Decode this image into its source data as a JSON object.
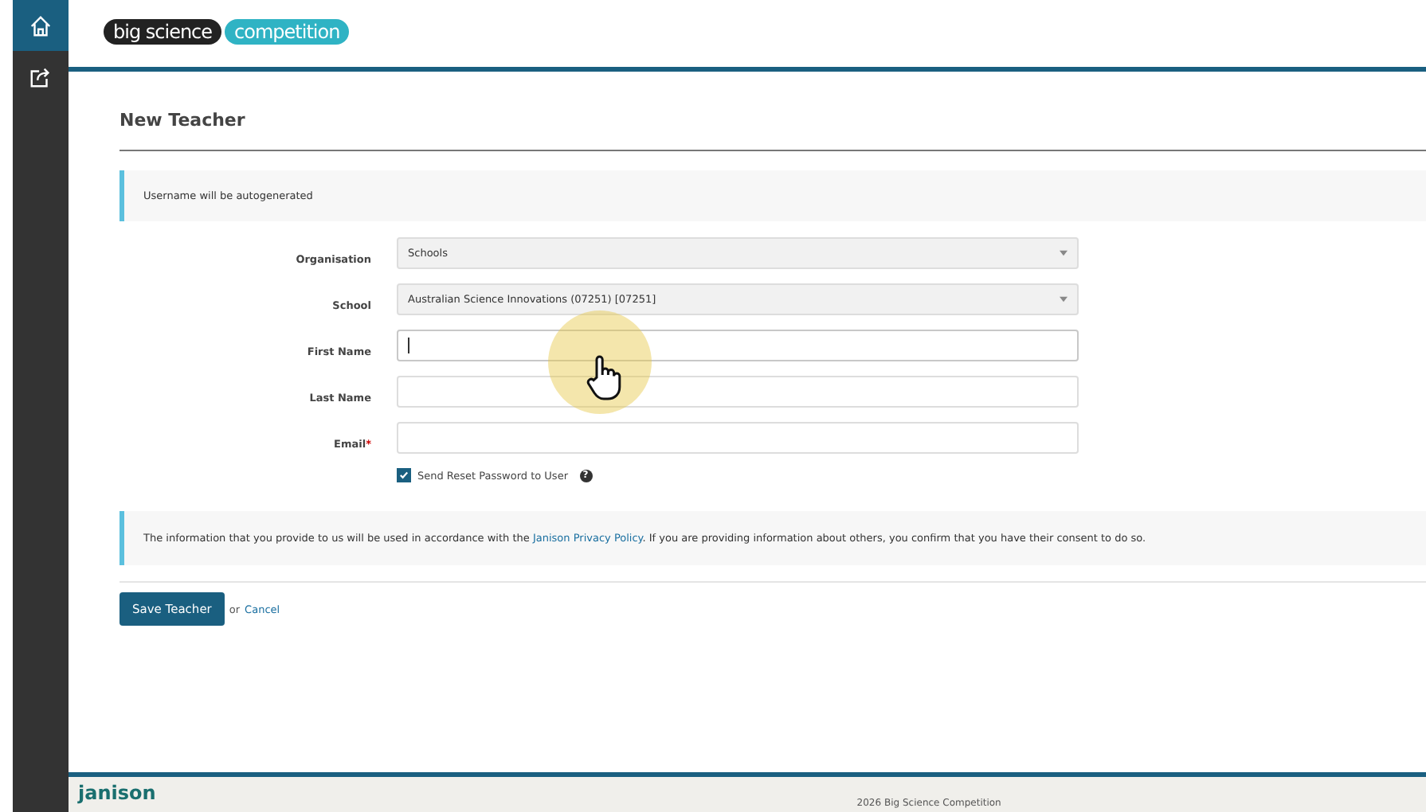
{
  "sidebar": {
    "items": [
      {
        "kind": "home",
        "selected": true
      },
      {
        "kind": "export",
        "selected": false
      }
    ]
  },
  "header": {
    "logo": {
      "part_1": "big science",
      "part_2": "competition"
    }
  },
  "page": {
    "title": "New Teacher",
    "notice": "Username will be autogenerated",
    "fields": [
      {
        "kind": "select",
        "label": "Organisation",
        "value": "Schools"
      },
      {
        "kind": "select",
        "label": "School",
        "value": "Australian Science Innovations (07251) [07251]"
      },
      {
        "kind": "text",
        "label": "First Name",
        "focused": true
      },
      {
        "kind": "text",
        "label": "Last Name",
        "focused": false
      },
      {
        "kind": "text",
        "label": "Email",
        "required_mark": "*",
        "focused": false
      }
    ],
    "checkbox": {
      "label": "Send Reset Password to User",
      "checked": true,
      "help": "?"
    },
    "privacy": {
      "before": "The information that you provide to us will be used in accordance with the",
      "link": "Janison Privacy Policy",
      "after": ". If you are providing information about others, you confirm that you have their consent to do so."
    },
    "save_button": "Save Teacher",
    "or": "or",
    "cancel": "Cancel"
  },
  "footer": {
    "brand": "janison",
    "text": "2026 Big Science Competition"
  }
}
